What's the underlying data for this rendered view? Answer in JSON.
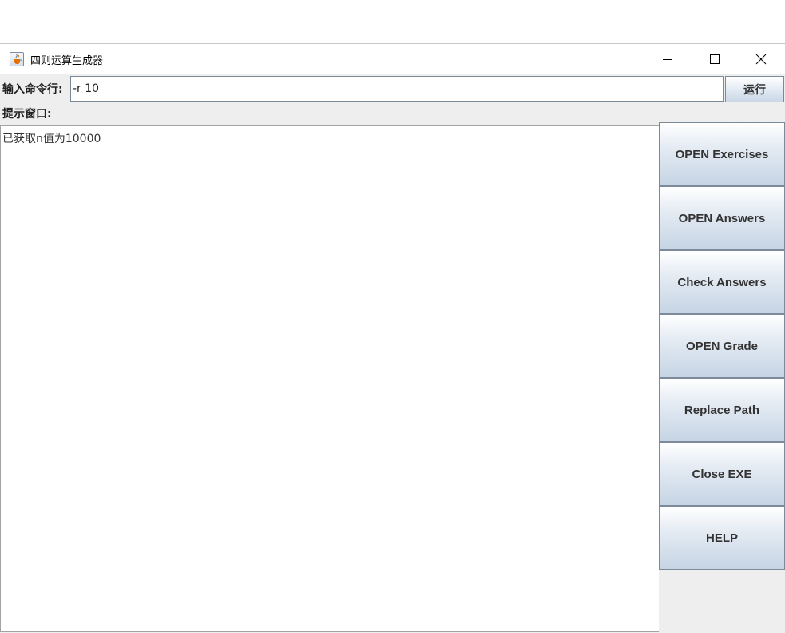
{
  "window": {
    "title": "四则运算生成器",
    "controls": {
      "minimize": "minimize",
      "maximize": "maximize",
      "close": "close"
    }
  },
  "command": {
    "label": "输入命令行:",
    "value": "-r 10",
    "run_label": "运行"
  },
  "prompt": {
    "label": "提示窗口:",
    "output": "已获取n值为10000"
  },
  "side_buttons": [
    "OPEN Exercises",
    "OPEN Answers",
    "Check Answers",
    "OPEN Grade",
    "Replace Path",
    "Close EXE",
    "HELP"
  ],
  "icons": {
    "app": "java-cup-icon",
    "minimize": "minimize-icon",
    "maximize": "maximize-icon",
    "close": "close-icon"
  },
  "colors": {
    "window_bg": "#eeeeee",
    "button_border": "#7a8a99",
    "button_gradient_top": "#ffffff",
    "button_gradient_bottom": "#c6d4e4",
    "text": "#333333"
  }
}
